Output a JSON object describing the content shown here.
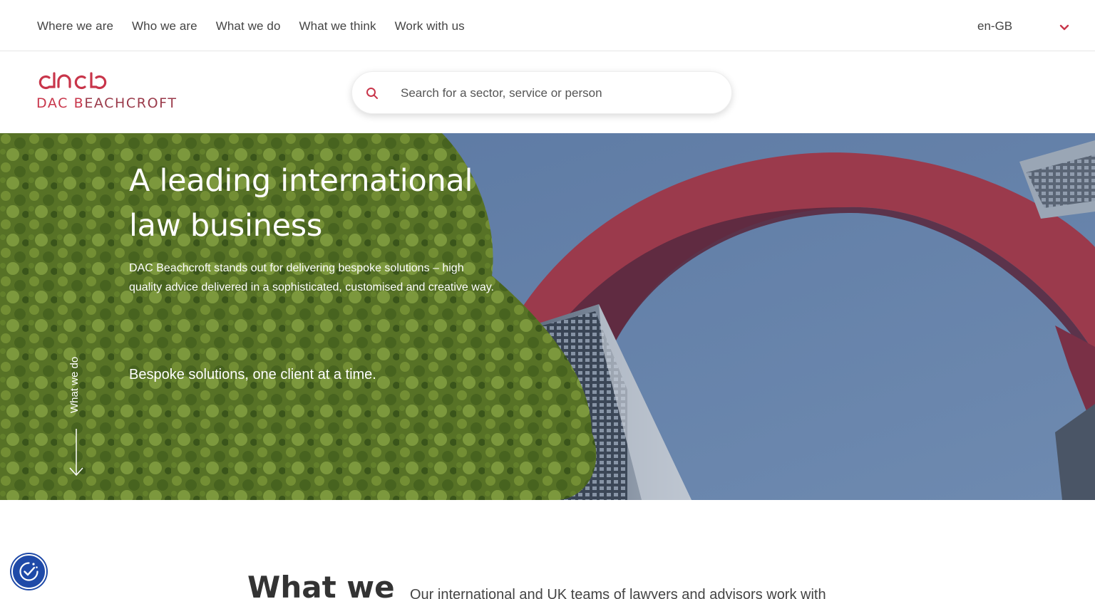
{
  "nav": {
    "links": [
      "Where we are",
      "Who we are",
      "What we do",
      "What we think",
      "Work with us"
    ],
    "language": "en-GB"
  },
  "brand": {
    "logo_text_prefix": "DAC B",
    "logo_text_rest": "EACHCROFT",
    "brand_color": "#c8354a"
  },
  "search": {
    "placeholder": "Search for a sector, service or person"
  },
  "hero": {
    "title": "A leading international law business",
    "description": "DAC Beachcroft stands out for delivering bespoke solutions – high quality advice delivered in a sophisticated, customised and creative way.",
    "tagline": "Bespoke solutions, one client at a time.",
    "side_label": "What we do"
  },
  "section": {
    "title": "What we",
    "text": "Our international and UK teams of lawyers and advisors work with"
  },
  "colors": {
    "sky": "#5f7ba4",
    "arch": "#9b3a4c",
    "cookie_button": "#1f4aa8"
  }
}
